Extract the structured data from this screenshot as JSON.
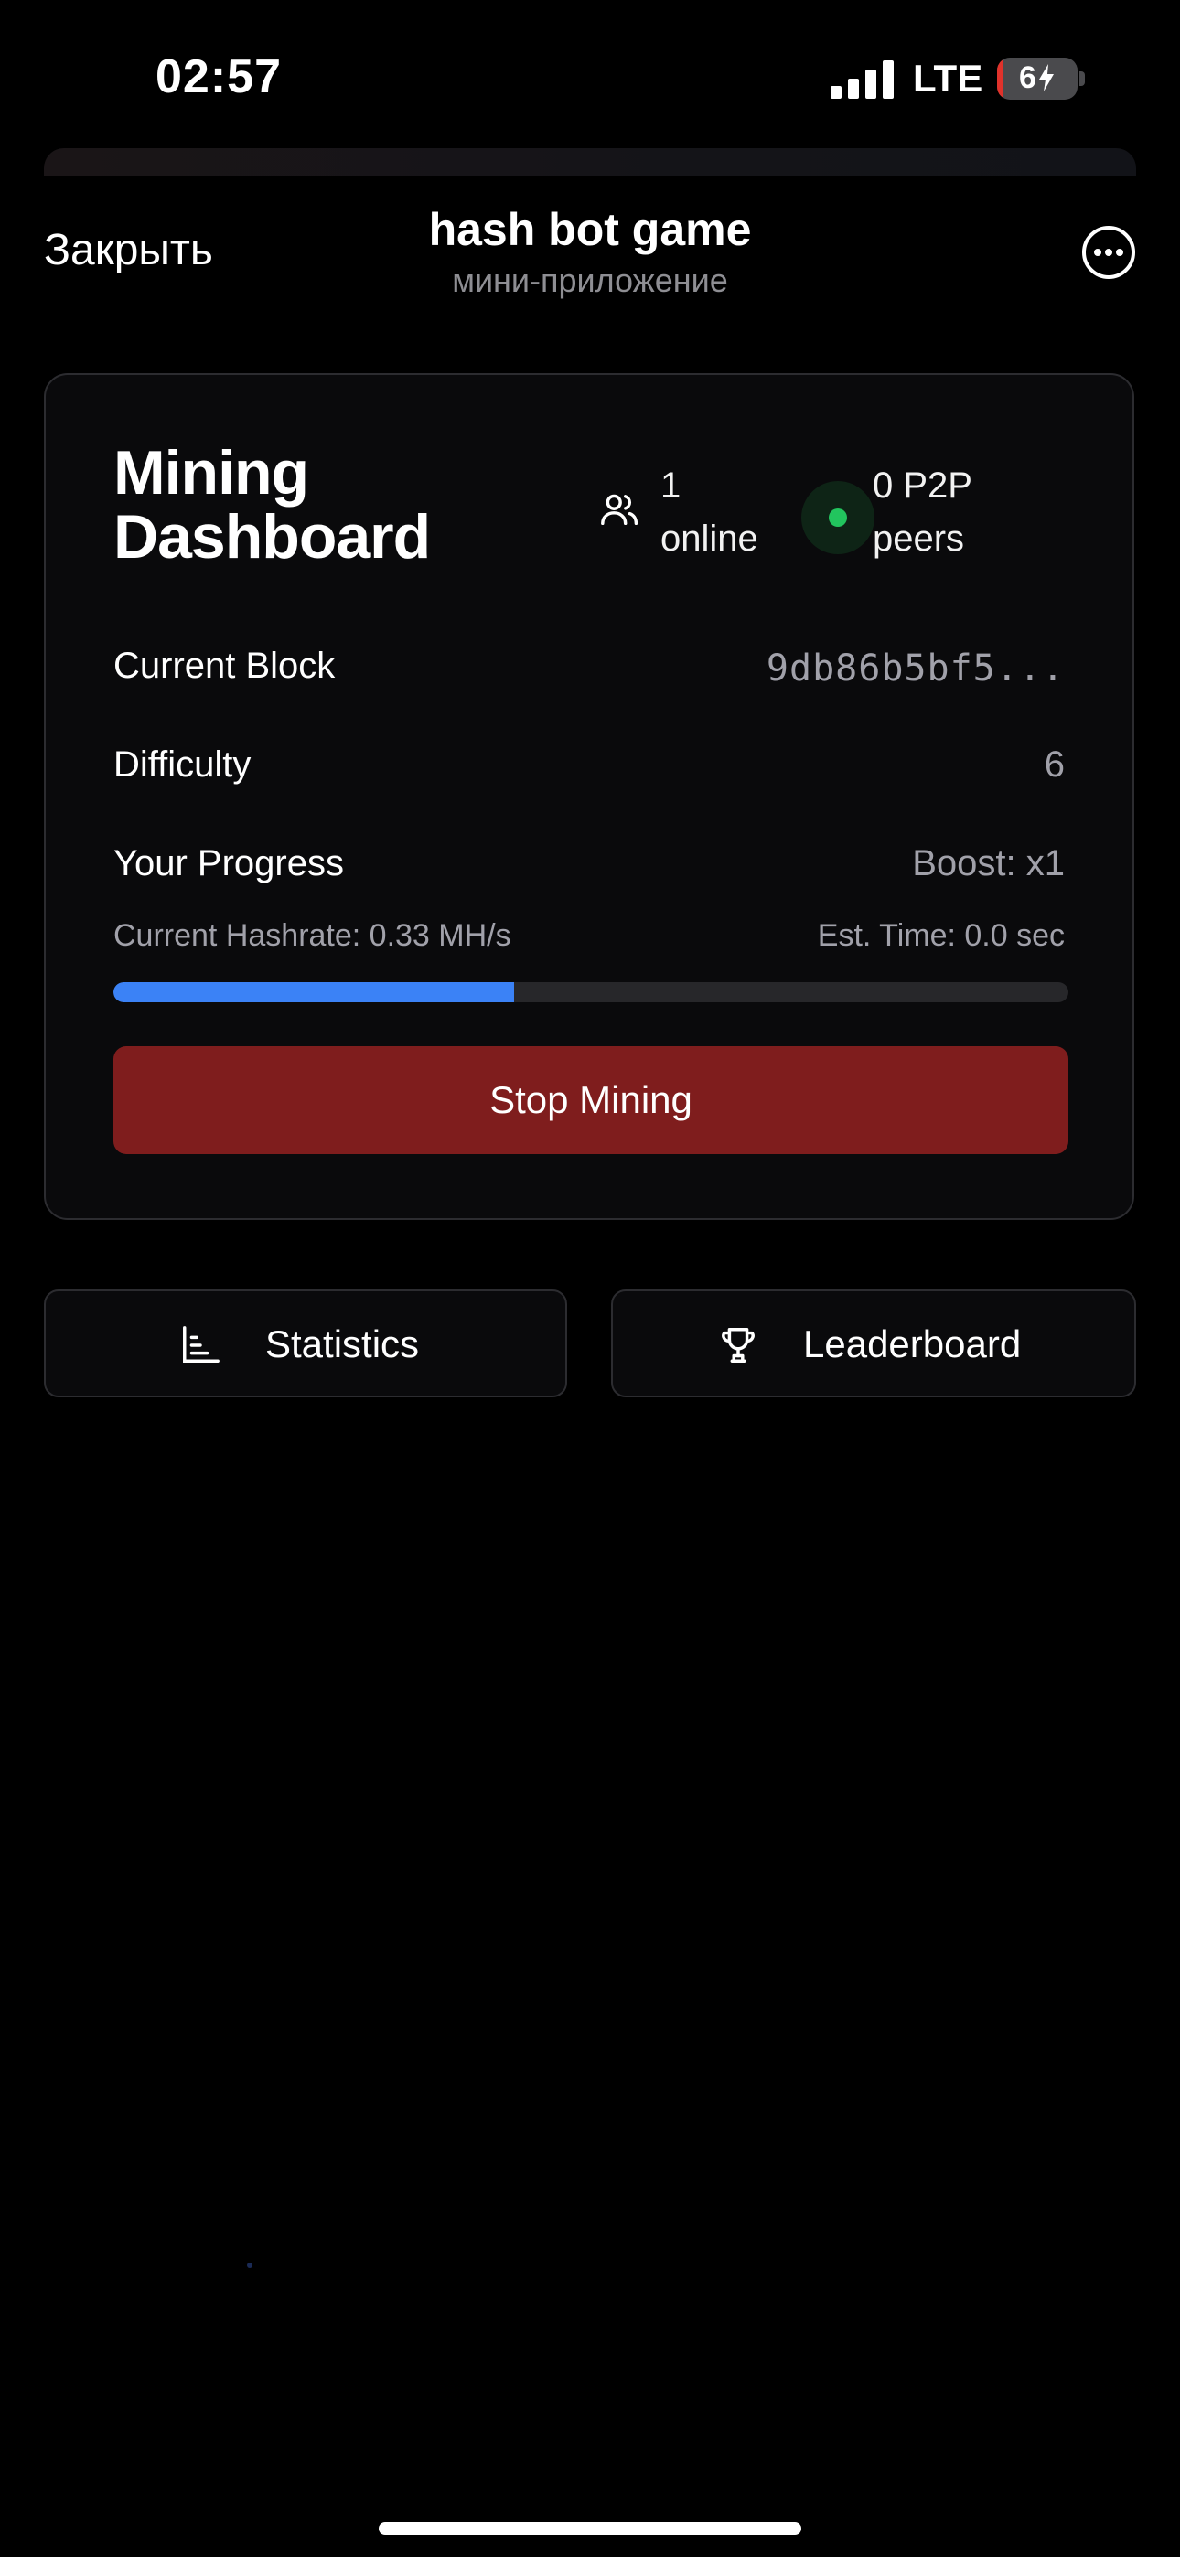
{
  "status_bar": {
    "time": "02:57",
    "network": "LTE",
    "battery_percent": "6",
    "icons": [
      "signal-icon",
      "charging-bolt-icon"
    ]
  },
  "header": {
    "close_label": "Закрыть",
    "title": "hash bot game",
    "subtitle": "мини-приложение",
    "more_icon": "more-horizontal-circle-icon"
  },
  "dashboard": {
    "title": "Mining Dashboard",
    "online_count": "1 online",
    "peers": "0 P2P peers",
    "peer_status_color": "#22c55e",
    "current_block_label": "Current Block",
    "current_block_value": "9db86b5bf5...",
    "difficulty_label": "Difficulty",
    "difficulty_value": "6",
    "progress_label": "Your Progress",
    "boost": "Boost: x1",
    "hashrate": "Current Hashrate: 0.33 MH/s",
    "est_time": "Est. Time: 0.0 sec",
    "progress_fraction": 0.42,
    "progress_color": "#3b82f6",
    "stop_button_label": "Stop Mining",
    "stop_button_color": "#7f1d1d"
  },
  "nav": {
    "statistics_label": "Statistics",
    "statistics_icon": "bar-chart-icon",
    "leaderboard_label": "Leaderboard",
    "leaderboard_icon": "trophy-icon"
  }
}
